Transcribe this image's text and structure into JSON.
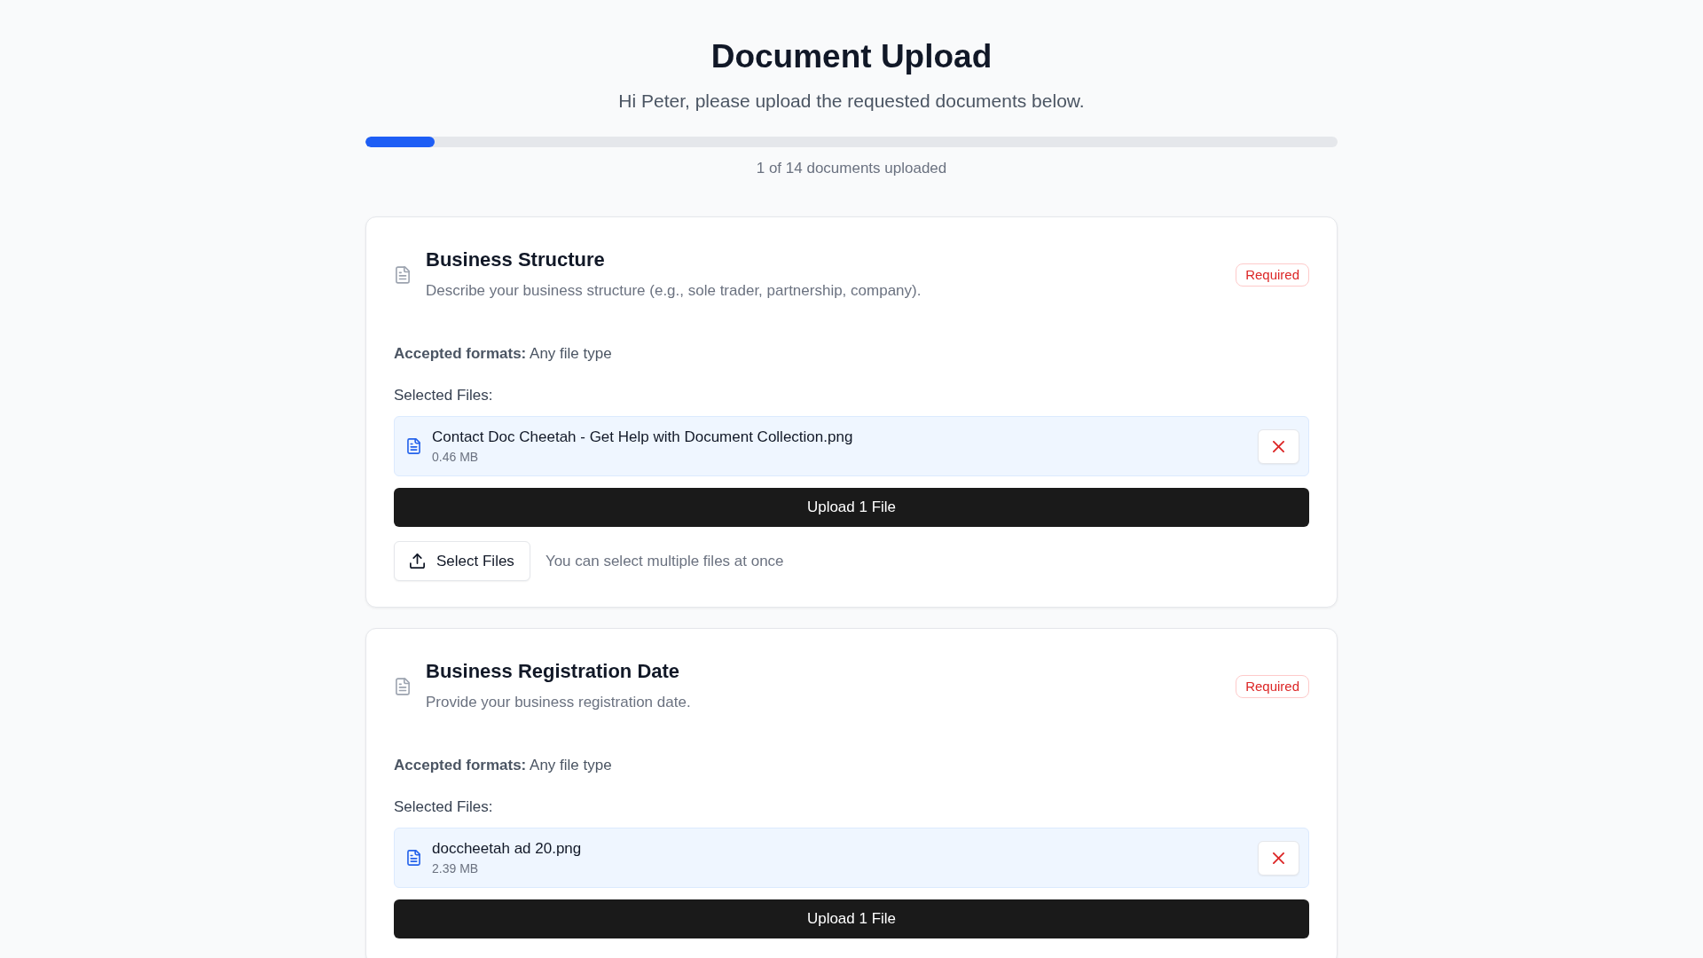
{
  "page": {
    "title": "Document Upload",
    "subtitle": "Hi Peter, please upload the requested documents below."
  },
  "progress": {
    "level": 0.0714,
    "label": "1 of 14 documents uploaded"
  },
  "documents": [
    {
      "title": "Business Structure",
      "description": "Describe your business structure (e.g., sole trader, partnership, company).",
      "badge": "Required",
      "formats": "**Accepted formats:** Any file type",
      "selected_label": "Selected Files:",
      "files": [
        {
          "name": "Contact Doc Cheetah - Get Help with Document Collection.png",
          "size": "0.46 MB"
        }
      ],
      "upload_button": "Upload 1 File",
      "select_button": "Select Files",
      "select_hint": "You can select multiple files at once"
    },
    {
      "title": "Business Registration Date",
      "description": "Provide your business registration date.",
      "badge": "Required",
      "formats": "**Accepted formats:** Any file type",
      "selected_label": "Selected Files:",
      "files": [
        {
          "name": "doccheetah ad 20.png",
          "size": "2.39 MB"
        }
      ],
      "upload_button": "Upload 1 File"
    }
  ]
}
